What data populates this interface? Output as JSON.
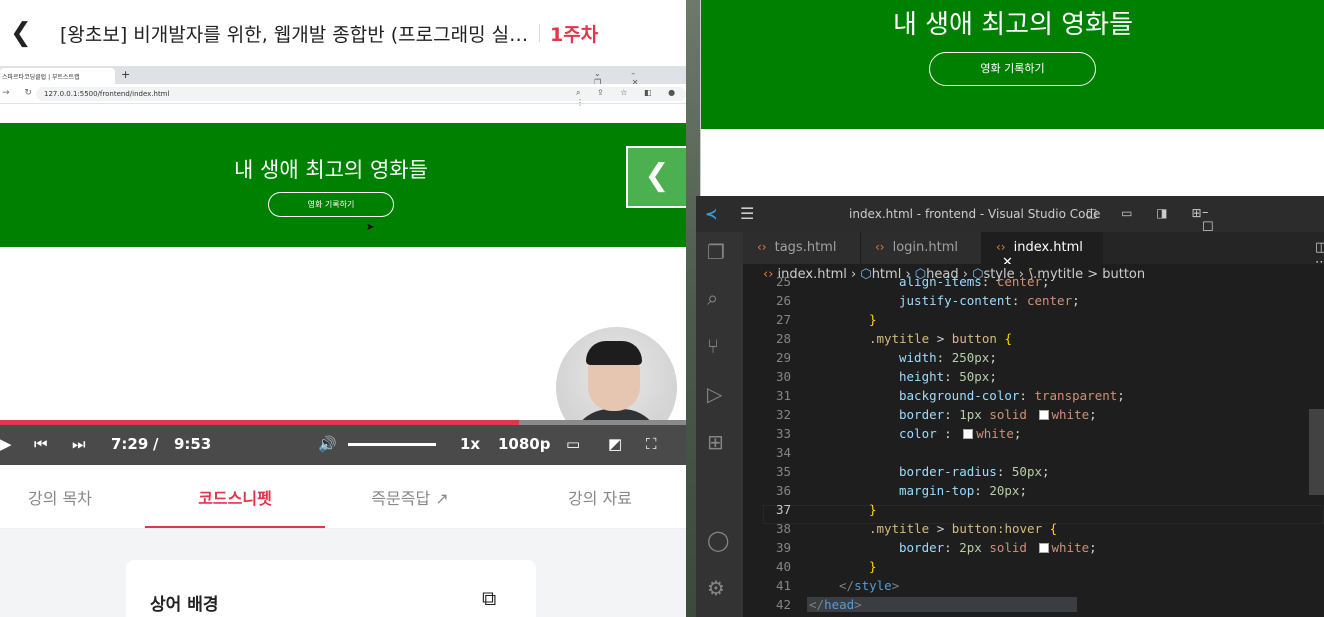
{
  "lecture": {
    "title": "[왕초보] 비개발자를 위한, 웹개발 종합반 (프로그래밍 실무...",
    "week": "1주차",
    "browser": {
      "tab_title": "스파르타코딩클럽 | 부트스트랩",
      "url": "127.0.0.1:5500/frontend/index.html"
    },
    "site": {
      "title": "내 생애 최고의 영화들",
      "button": "영화 기록하기"
    },
    "player": {
      "current_time": "7:29",
      "separator": "/",
      "duration": "9:53",
      "progress_fraction": 0.757,
      "speed": "1x",
      "quality": "1080p"
    },
    "tabs": [
      "강의 목차",
      "코드스니펫",
      "즉문즉답",
      "강의 자료"
    ],
    "active_tab": "코드스니펫",
    "snippet_title": "상어 배경"
  },
  "right_browser": {
    "title": "내 생애 최고의 영화들",
    "button": "영화 기록하기"
  },
  "vscode": {
    "window_title": "index.html - frontend - Visual Studio Code",
    "tabs": [
      "tags.html",
      "login.html",
      "index.html"
    ],
    "breadcrumb": [
      "index.html",
      "html",
      "head",
      "style",
      ".mytitle > button"
    ],
    "lines": [
      {
        "n": "25",
        "text": "align-items: center;"
      },
      {
        "n": "26",
        "text": "justify-content: center;"
      },
      {
        "n": "27",
        "text": "}"
      },
      {
        "n": "28",
        "text": ".mytitle > button {"
      },
      {
        "n": "29",
        "text": "width: 250px;"
      },
      {
        "n": "30",
        "text": "height: 50px;"
      },
      {
        "n": "31",
        "text": "background-color: transparent;"
      },
      {
        "n": "32",
        "text": "border: 1px solid white;"
      },
      {
        "n": "33",
        "text": "color : white;"
      },
      {
        "n": "34",
        "text": ""
      },
      {
        "n": "35",
        "text": "border-radius: 50px;"
      },
      {
        "n": "36",
        "text": "margin-top: 20px;"
      },
      {
        "n": "37",
        "text": "}"
      },
      {
        "n": "38",
        "text": ".mytitle > button:hover {"
      },
      {
        "n": "39",
        "text": "border: 2px solid white;"
      },
      {
        "n": "40",
        "text": "}"
      },
      {
        "n": "41",
        "text": "</style>"
      },
      {
        "n": "42",
        "text": "</head>"
      }
    ]
  },
  "colors": {
    "accent": "#e0364b",
    "site_green": "#008000"
  }
}
